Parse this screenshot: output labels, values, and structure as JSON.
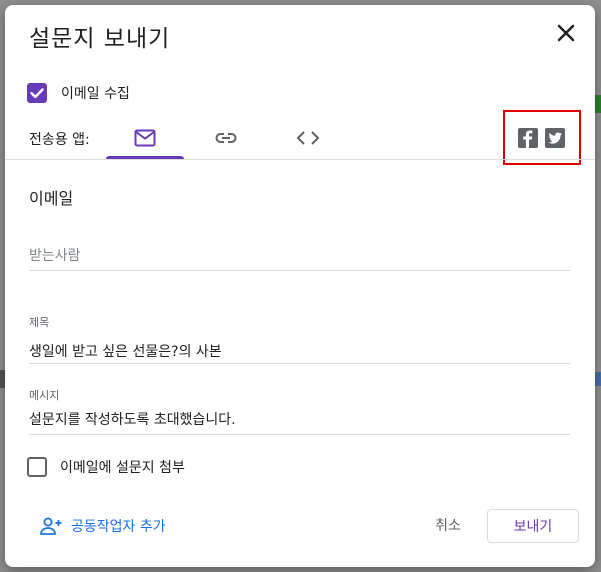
{
  "dialog": {
    "title": "설문지 보내기"
  },
  "collect_email": {
    "label": "이메일 수집",
    "checked": true
  },
  "send_via": {
    "label": "전송용 앱:",
    "tabs": [
      {
        "name": "email",
        "icon": "mail-icon",
        "active": true
      },
      {
        "name": "link",
        "icon": "link-icon",
        "active": false
      },
      {
        "name": "embed",
        "icon": "code-icon",
        "active": false
      }
    ],
    "social": [
      {
        "name": "facebook",
        "icon": "facebook-icon"
      },
      {
        "name": "twitter",
        "icon": "twitter-icon"
      }
    ]
  },
  "email_section": {
    "heading": "이메일",
    "to_placeholder": "받는사람",
    "subject_label": "제목",
    "subject_value": "생일에 받고 싶은 선물은?의 사본",
    "message_label": "메시지",
    "message_value": "설문지를 작성하도록 초대했습니다.",
    "attach_label": "이메일에 설문지 첨부",
    "attach_checked": false
  },
  "footer": {
    "add_collaborators": "공동작업자 추가",
    "cancel": "취소",
    "send": "보내기"
  },
  "colors": {
    "accent": "#673ab7",
    "link": "#1a73e8",
    "highlight": "#e00000"
  }
}
